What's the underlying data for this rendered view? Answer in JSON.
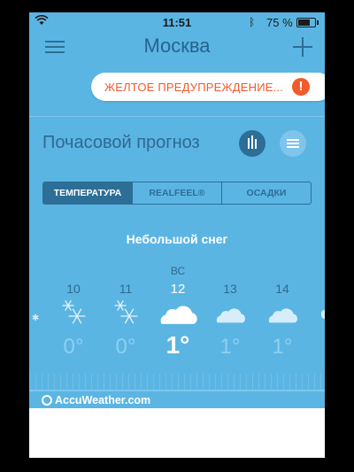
{
  "status_bar": {
    "time": "11:51",
    "battery": "75 %",
    "battery_level": 0.75
  },
  "header": {
    "title": "Москва"
  },
  "warning": {
    "text": "ЖЕЛТОЕ ПРЕДУПРЕЖДЕНИЕ...",
    "badge": "!"
  },
  "section": {
    "title": "Почасовой прогноз"
  },
  "tabs": [
    {
      "label": "ТЕМПЕРАТУРА",
      "active": true
    },
    {
      "label": "REALFEEL®",
      "active": false
    },
    {
      "label": "ОСАДКИ",
      "active": false
    }
  ],
  "forecast": {
    "condition": "Небольшой снег",
    "day_label": "ВС",
    "left_edge_temp": "°",
    "hours": [
      {
        "hour": "10",
        "temp": "0°",
        "icon": "snow-icon"
      },
      {
        "hour": "11",
        "temp": "0°",
        "icon": "snow-icon"
      },
      {
        "hour": "12",
        "temp": "1°",
        "icon": "cloud-icon",
        "current": true
      },
      {
        "hour": "13",
        "temp": "1°",
        "icon": "cloud-icon"
      },
      {
        "hour": "14",
        "temp": "1°",
        "icon": "cloud-icon"
      }
    ]
  },
  "brand": {
    "name": "AccuWeather.com"
  },
  "colors": {
    "background": "#5bb5e3",
    "dark_accent": "#2c6e96",
    "warning": "#f05a2c"
  }
}
